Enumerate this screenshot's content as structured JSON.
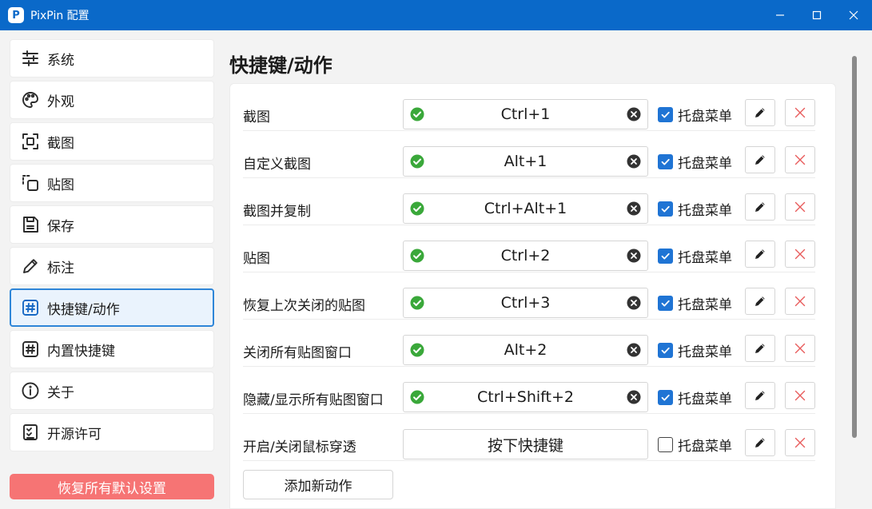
{
  "window": {
    "title": "PixPin 配置",
    "logo_letter": "P"
  },
  "sidebar": {
    "items": [
      {
        "label": "系统",
        "icon": "sliders-icon"
      },
      {
        "label": "外观",
        "icon": "palette-icon"
      },
      {
        "label": "截图",
        "icon": "screenshot-icon"
      },
      {
        "label": "贴图",
        "icon": "pin-copy-icon"
      },
      {
        "label": "保存",
        "icon": "save-icon"
      },
      {
        "label": "标注",
        "icon": "pencil-icon"
      },
      {
        "label": "快捷键/动作",
        "icon": "hash-icon",
        "active": true
      },
      {
        "label": "内置快捷键",
        "icon": "hash-icon"
      },
      {
        "label": "关于",
        "icon": "info-icon"
      },
      {
        "label": "开源许可",
        "icon": "checklist-icon"
      }
    ],
    "reset_label": "恢复所有默认设置"
  },
  "main": {
    "title": "快捷键/动作",
    "tray_label": "托盘菜单",
    "actions": [
      {
        "name": "截图",
        "hotkey": "Ctrl+1",
        "valid": true,
        "tray": true
      },
      {
        "name": "自定义截图",
        "hotkey": "Alt+1",
        "valid": true,
        "tray": true
      },
      {
        "name": "截图并复制",
        "hotkey": "Ctrl+Alt+1",
        "valid": true,
        "tray": true
      },
      {
        "name": "贴图",
        "hotkey": "Ctrl+2",
        "valid": true,
        "tray": true
      },
      {
        "name": "恢复上次关闭的贴图",
        "hotkey": "Ctrl+3",
        "valid": true,
        "tray": true
      },
      {
        "name": "关闭所有贴图窗口",
        "hotkey": "Alt+2",
        "valid": true,
        "tray": true
      },
      {
        "name": "隐藏/显示所有贴图窗口",
        "hotkey": "Ctrl+Shift+2",
        "valid": true,
        "tray": true
      },
      {
        "name": "开启/关闭鼠标穿透",
        "hotkey": "按下快捷键",
        "valid": false,
        "tray": false
      }
    ],
    "add_label": "添加新动作"
  },
  "colors": {
    "titlebar": "#0a69c9",
    "accent": "#1f74d4",
    "ok_green": "#3aa83a",
    "delete_red": "#e85c5c",
    "reset_bg": "#f67474"
  }
}
